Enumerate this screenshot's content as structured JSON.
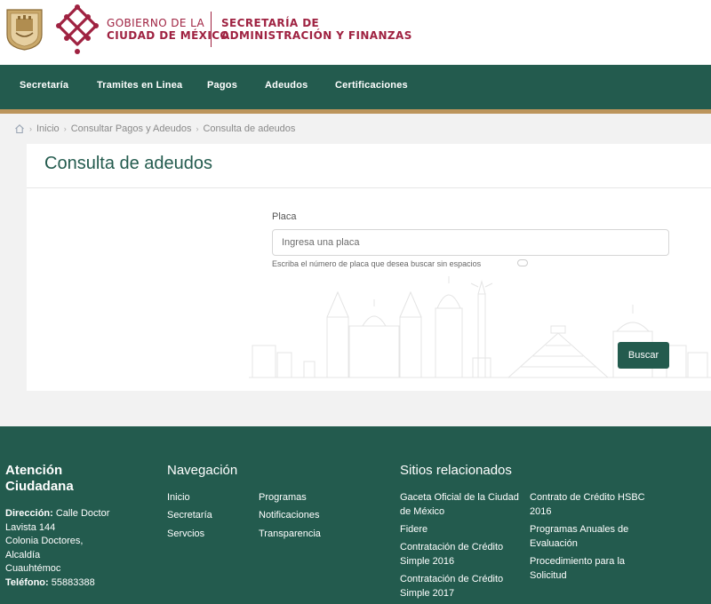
{
  "header": {
    "gob_line1": "GOBIERNO DE LA",
    "gob_line2": "CIUDAD DE MÉXICO",
    "sec_line1": "SECRETARÍA DE",
    "sec_line2": "ADMINISTRACIÓN Y FINANZAS",
    "brand_color": "#9f2241"
  },
  "nav": {
    "items": [
      "Secretaría",
      "Tramites en Linea",
      "Pagos",
      "Adeudos",
      "Certificaciones"
    ],
    "bg_color": "#235b4e",
    "stripe_color": "#bc955c"
  },
  "breadcrumb": {
    "home_icon": "home-icon",
    "items": [
      "Inicio",
      "Consultar Pagos y Adeudos",
      "Consulta de adeudos"
    ]
  },
  "form": {
    "title": "Consulta de adeudos",
    "label": "Placa",
    "placeholder": "Ingresa una placa",
    "help": "Escriba el número de placa que desea buscar sin espacios",
    "button": "Buscar"
  },
  "footer": {
    "attention": {
      "heading_line1": "Atención",
      "heading_line2": "Ciudadana",
      "address_label": "Dirección:",
      "address_line1": "Calle Doctor",
      "address_line2": "Lavista 144",
      "address_line3": "Colonia Doctores,",
      "address_line4": "Alcaldía",
      "address_line5": "Cuauhtémoc",
      "phone_label": "Teléfono:",
      "phone": "55883388"
    },
    "navigation": {
      "heading": "Navegación",
      "col1": [
        "Inicio",
        "Secretaría",
        "Servcios"
      ],
      "col2": [
        "Programas",
        "Notificaciones",
        "Transparencia"
      ]
    },
    "related": {
      "heading": "Sitios relacionados",
      "col1": [
        [
          "Gaceta Oficial de la Ciudad",
          "de México"
        ],
        [
          "Fidere"
        ],
        [
          "Contratación de Crédito",
          "Simple 2016"
        ],
        [
          "Contratación de Crédito",
          "Simple 2017"
        ]
      ],
      "col2": [
        [
          "Contrato de Crédito HSBC",
          "2016"
        ],
        [
          "Programas Anuales de",
          "Evaluación"
        ],
        [
          "Procedimiento para la",
          "Solicitud"
        ]
      ]
    }
  }
}
